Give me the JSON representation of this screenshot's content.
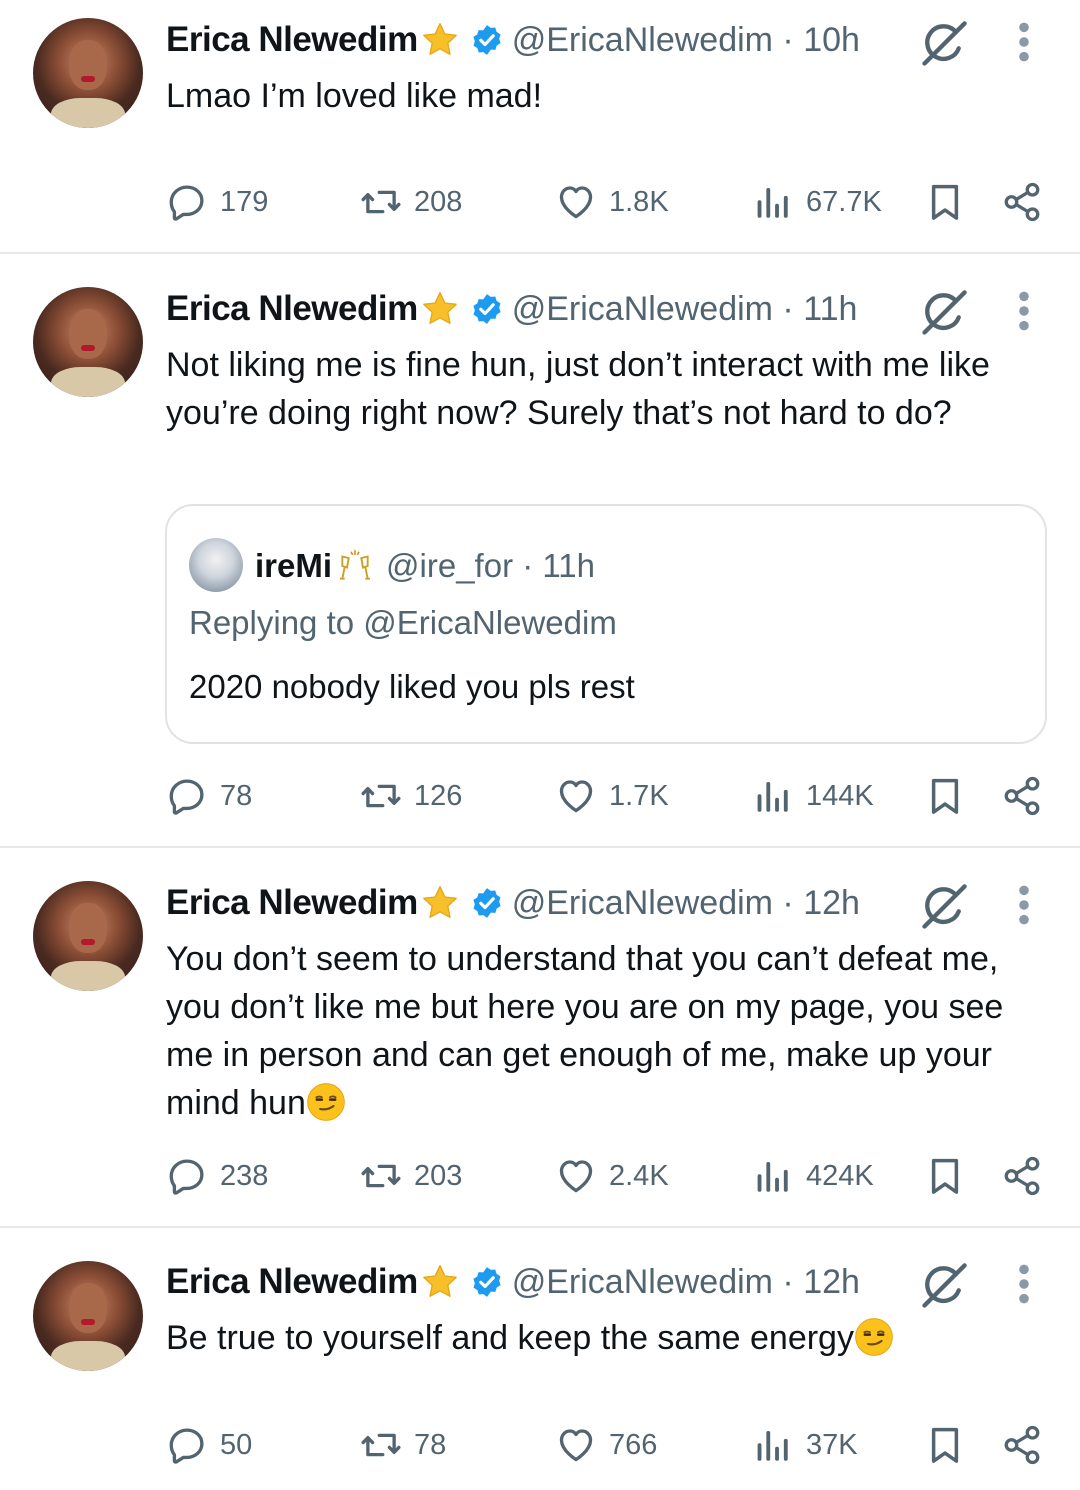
{
  "colors": {
    "text": "#0f1419",
    "secondary": "#536471",
    "verified": "#1d9bf0",
    "divider": "#e6e9ec"
  },
  "tweets": [
    {
      "name": "Erica Nlewedim",
      "meta": "@EricaNlewedim · 10h",
      "text": "Lmao I’m loved like mad!",
      "emoji": "",
      "quote": null,
      "stats": {
        "replies": "179",
        "reposts": "208",
        "likes": "1.8K",
        "views": "67.7K"
      }
    },
    {
      "name": "Erica Nlewedim",
      "meta": "@EricaNlewedim · 11h",
      "text": "Not liking me is fine hun, just don’t interact with me like you’re doing right now? Surely that’s not hard to do?",
      "emoji": "",
      "quote": {
        "name": "ireMi",
        "meta": "@ire_for · 11h",
        "reply_prefix": "Replying to ",
        "reply_handle": "@EricaNlewedim",
        "text": "2020 nobody liked you pls rest"
      },
      "stats": {
        "replies": "78",
        "reposts": "126",
        "likes": "1.7K",
        "views": "144K"
      }
    },
    {
      "name": "Erica Nlewedim",
      "meta": "@EricaNlewedim · 12h",
      "text": "You don’t seem to understand that you can’t defeat me, you don’t like me but here you are on my page, you see me in person and can get enough of me, make up your mind hun",
      "emoji": "smirk",
      "quote": null,
      "stats": {
        "replies": "238",
        "reposts": "203",
        "likes": "2.4K",
        "views": "424K"
      }
    },
    {
      "name": "Erica Nlewedim",
      "meta": "@EricaNlewedim · 12h",
      "text": "Be true to yourself and keep the same energy",
      "emoji": "smirk",
      "quote": null,
      "stats": {
        "replies": "50",
        "reposts": "78",
        "likes": "766",
        "views": "37K"
      }
    }
  ]
}
